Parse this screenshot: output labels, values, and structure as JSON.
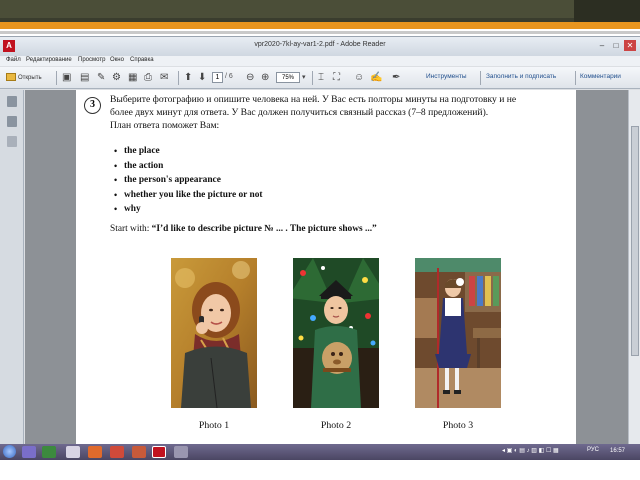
{
  "window": {
    "title": "vpr2020-7kl-ay-var1-2.pdf - Adobe Reader",
    "min": "–",
    "max": "□",
    "close": "✕"
  },
  "menu": [
    "Файл",
    "Редактирование",
    "Просмотр",
    "Окно",
    "Справка"
  ],
  "toolbar": {
    "open_label": "Открыть",
    "page_current": "1",
    "page_total": "/ 6",
    "zoom": "75%",
    "tools": "Инструменты",
    "fill_sign": "Заполнить и подписать",
    "comments": "Комментарии"
  },
  "task": {
    "number": "3",
    "line1": "Выберите фотографию и опишите человека на ней. У Вас есть полторы минуты на подготовку и не",
    "line2": "более двух минут для ответа. У Вас должен получиться связный рассказ (7–8 предложений).",
    "line3": "План ответа поможет Вам:",
    "bullets": [
      "the place",
      "the action",
      "the person's appearance",
      "whether you like the picture or not",
      "why"
    ],
    "start_prefix": "Start with: ",
    "start_quote": "“I’d like to describe picture № ... . The picture shows ...”"
  },
  "photos": [
    "Photo 1",
    "Photo 2",
    "Photo 3"
  ],
  "taskbar": {
    "lang": "РУС",
    "time": "16:57"
  },
  "colors": {
    "accent_orange": "#e8951f",
    "slide_band": "#4b4e38",
    "adobe_red": "#c1121f"
  }
}
